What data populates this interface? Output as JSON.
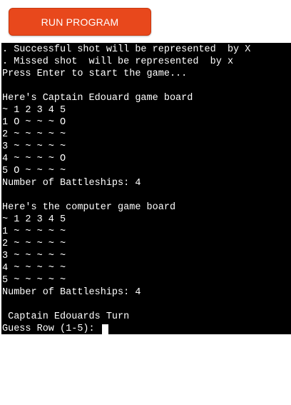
{
  "toolbar": {
    "run_label": "RUN PROGRAM"
  },
  "colors": {
    "run_button": "#e8481c",
    "terminal_bg": "#000000",
    "terminal_text": "#ffffff"
  },
  "terminal": {
    "lines": [
      ". Successful shot will be represented  by X",
      ". Missed shot  will be represented  by x",
      "Press Enter to start the game...",
      "",
      "Here's Captain Edouard game board",
      "~ 1 2 3 4 5",
      "1 O ~ ~ ~ O",
      "2 ~ ~ ~ ~ ~",
      "3 ~ ~ ~ ~ ~",
      "4 ~ ~ ~ ~ O",
      "5 O ~ ~ ~ ~",
      "Number of Battleships: 4",
      "",
      "Here's the computer game board",
      "~ 1 2 3 4 5",
      "1 ~ ~ ~ ~ ~",
      "2 ~ ~ ~ ~ ~",
      "3 ~ ~ ~ ~ ~",
      "4 ~ ~ ~ ~ ~",
      "5 ~ ~ ~ ~ ~",
      "Number of Battleships: 4",
      "",
      " Captain Edouards Turn"
    ],
    "prompt": "Guess Row (1-5): "
  }
}
